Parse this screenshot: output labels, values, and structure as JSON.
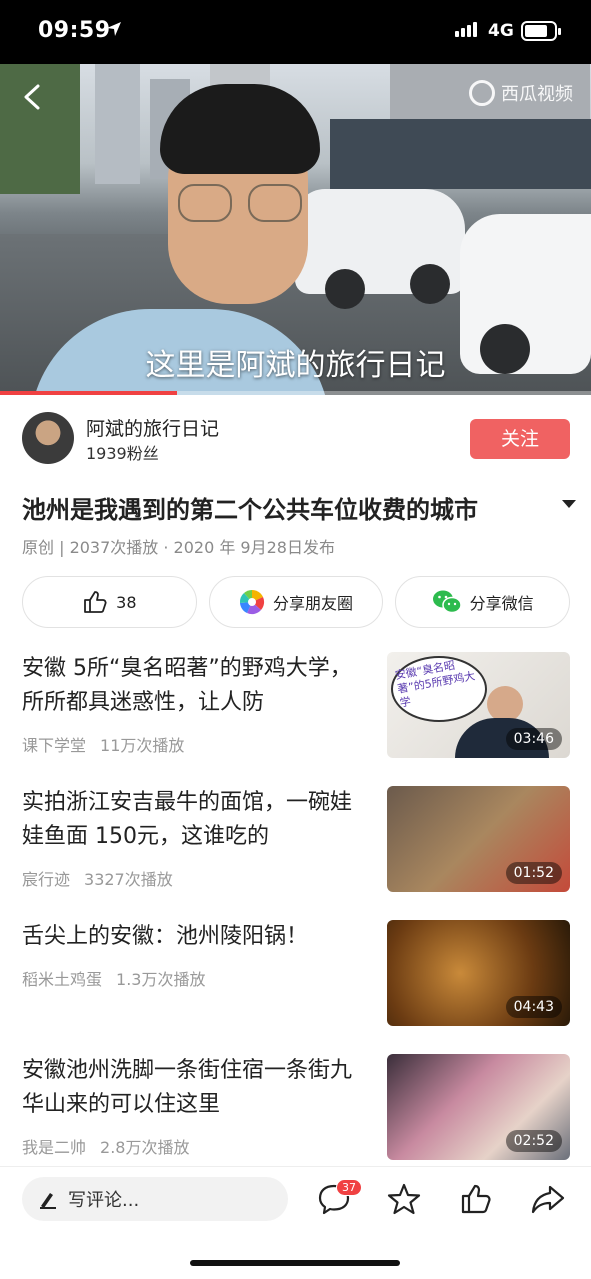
{
  "status_bar": {
    "time": "09:59",
    "network": "4G"
  },
  "video": {
    "watermark": "西瓜视频",
    "subtitle": "这里是阿斌的旅行日记",
    "progress": 0.3
  },
  "author": {
    "name": "阿斌的旅行日记",
    "fans": "1939粉丝",
    "follow_label": "关注"
  },
  "video_info": {
    "title": "池州是我遇到的第二个公共车位收费的城市",
    "meta": "原创 | 2037次播放 · 2020 年 9月28日发布"
  },
  "actions": {
    "like_count": "38",
    "share_moments": "分享朋友圈",
    "share_wechat": "分享微信"
  },
  "related": [
    {
      "title": "安徽 5所“臭名昭著”的野鸡大学，所所都具迷惑性，让人防",
      "author": "课下学堂",
      "plays": "11万次播放",
      "duration": "03:46",
      "thumb_text": "安徽“臭名昭著”的5所野鸡大学"
    },
    {
      "title": "实拍浙江安吉最牛的面馆，一碗娃娃鱼面 150元，这谁吃的",
      "author": "宸行迹",
      "plays": "3327次播放",
      "duration": "01:52"
    },
    {
      "title": "舌尖上的安徽：池州陵阳锅！",
      "author": "稻米土鸡蛋",
      "plays": "1.3万次播放",
      "duration": "04:43"
    },
    {
      "title": "安徽池州洗脚一条街住宿一条街九华山来的可以住这里",
      "author": "我是二帅",
      "plays": "2.8万次播放",
      "duration": "02:52"
    }
  ],
  "bottom_bar": {
    "comment_placeholder": "写评论...",
    "comment_count": "37"
  },
  "colors": {
    "accent": "#f04142",
    "follow_bg": "#f06262",
    "meta_gray": "#999999"
  }
}
